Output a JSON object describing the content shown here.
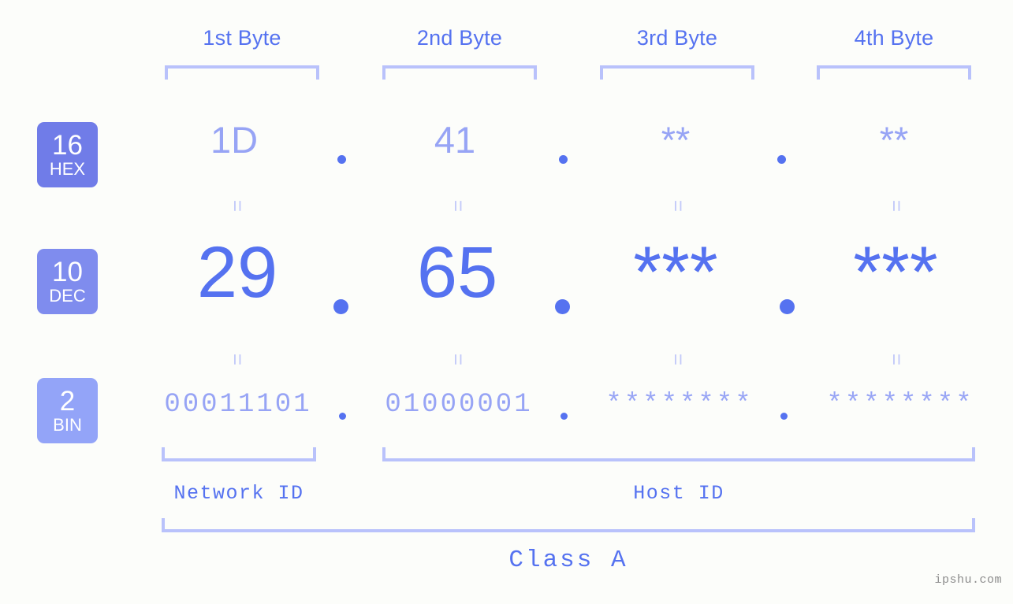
{
  "background_color": "#fcfdfa",
  "accent_color": "#5572f0",
  "accent_light_color": "#97a4f5",
  "bracket_color": "#b9c2fb",
  "byte_headers": [
    {
      "label": "1st Byte"
    },
    {
      "label": "2nd Byte"
    },
    {
      "label": "3rd Byte"
    },
    {
      "label": "4th Byte"
    }
  ],
  "bases": [
    {
      "number": "16",
      "name": "HEX",
      "color": "#707ce8"
    },
    {
      "number": "10",
      "name": "DEC",
      "color": "#7f8cee"
    },
    {
      "number": "2",
      "name": "BIN",
      "color": "#93a4f8"
    }
  ],
  "rows": {
    "hex": {
      "values": [
        "1D",
        "41",
        "**",
        "**"
      ],
      "separator": "."
    },
    "dec": {
      "values": [
        "29",
        "65",
        "***",
        "***"
      ],
      "separator": "."
    },
    "bin": {
      "values": [
        "00011101",
        "01000001",
        "********",
        "********"
      ],
      "separator": "."
    }
  },
  "equals_glyph": "=",
  "sections": {
    "network_id": "Network ID",
    "host_id": "Host ID",
    "class": "Class A"
  },
  "watermark": "ipshu.com"
}
